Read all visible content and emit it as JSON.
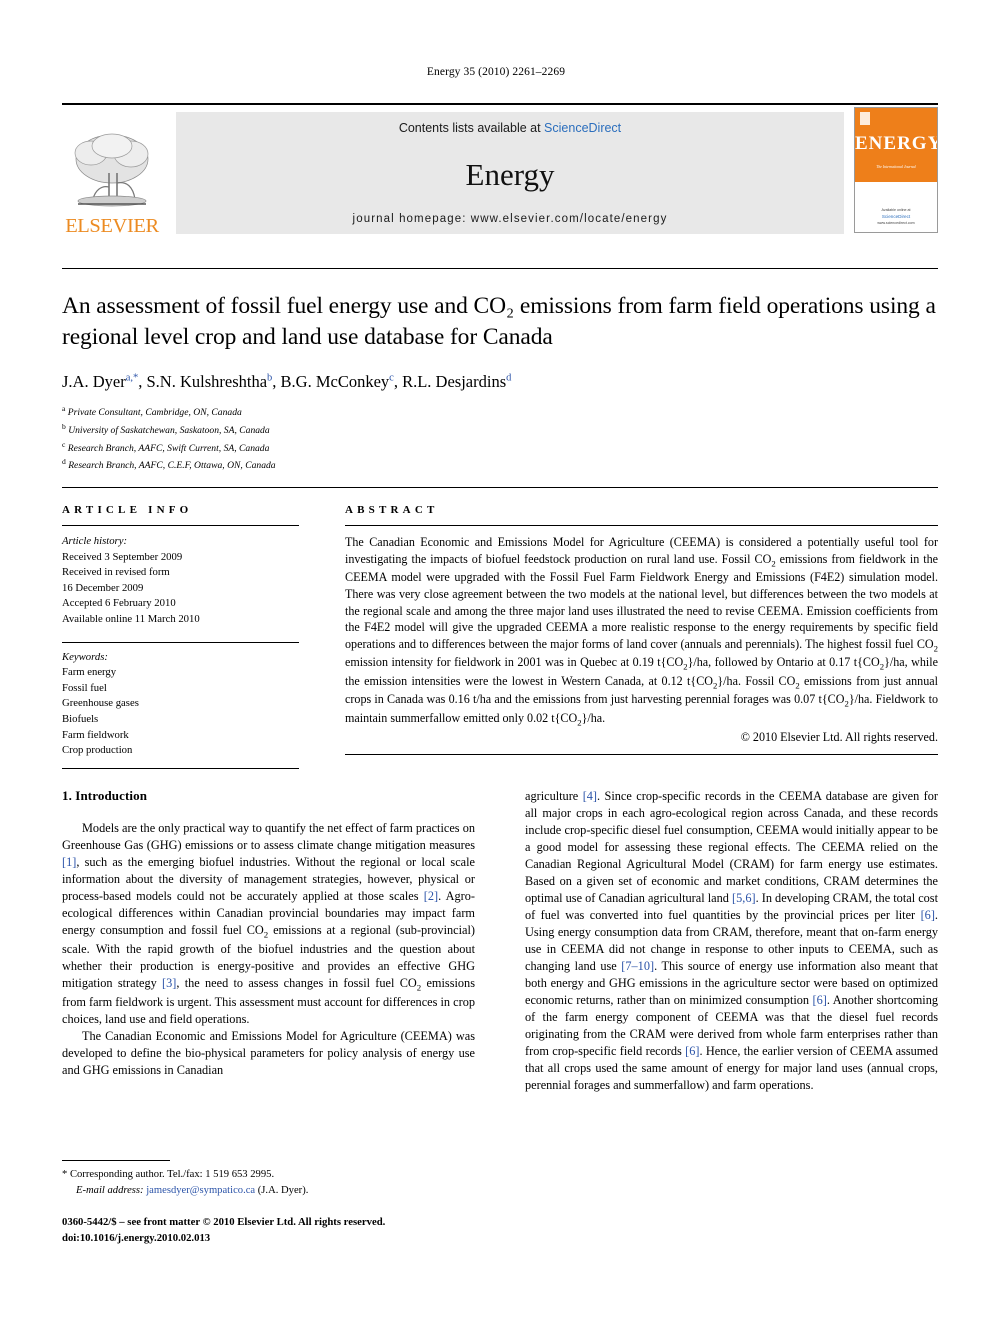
{
  "running_head": "Energy 35 (2010) 2261–2269",
  "masthead": {
    "contents_prefix": "Contents lists available at ",
    "sciencedirect": "ScienceDirect",
    "journal_name": "Energy",
    "homepage": "journal homepage: www.elsevier.com/locate/energy",
    "publisher_wordmark": "ELSEVIER",
    "publisher_logo_icon": "elsevier-tree-icon",
    "cover": {
      "title": "ENERGY",
      "subtitle": "The International Journal",
      "footer_prefix": "Available online at",
      "footer_brand": "ScienceDirect",
      "footer_url": "www.sciencedirect.com",
      "accent_color": "#ee7f1a"
    },
    "link_color": "#2b6ebd"
  },
  "article": {
    "title": "An assessment of fossil fuel energy use and CO₂ emissions from farm field operations using a regional level crop and land use database for Canada",
    "authors_html": "J.A. Dyer<sup>a,*</sup>, S.N. Kulshreshtha<sup>b</sup>, B.G. McConkey<sup>c</sup>, R.L. Desjardins<sup>d</sup>",
    "affiliations": [
      {
        "marker": "a",
        "text": "Private Consultant, Cambridge, ON, Canada"
      },
      {
        "marker": "b",
        "text": "University of Saskatchewan, Saskatoon, SA, Canada"
      },
      {
        "marker": "c",
        "text": "Research Branch, AAFC, Swift Current, SA, Canada"
      },
      {
        "marker": "d",
        "text": "Research Branch, AAFC, C.E.F, Ottawa, ON, Canada"
      }
    ]
  },
  "article_info": {
    "heading": "ARTICLE INFO",
    "history_label": "Article history:",
    "history": [
      "Received 3 September 2009",
      "Received in revised form",
      "16 December 2009",
      "Accepted 6 February 2010",
      "Available online 11 March 2010"
    ],
    "keywords_label": "Keywords:",
    "keywords": [
      "Farm energy",
      "Fossil fuel",
      "Greenhouse gases",
      "Biofuels",
      "Farm fieldwork",
      "Crop production"
    ]
  },
  "abstract": {
    "heading": "ABSTRACT",
    "body_html": "The Canadian Economic and Emissions Model for Agriculture (CEEMA) is considered a potentially useful tool for investigating the impacts of biofuel feedstock production on rural land use. Fossil CO<sub>2</sub> emissions from fieldwork in the CEEMA model were upgraded with the Fossil Fuel Farm Fieldwork Energy and Emissions (F4E2) simulation model. There was very close agreement between the two models at the national level, but differences between the two models at the regional scale and among the three major land uses illustrated the need to revise CEEMA. Emission coefficients from the F4E2 model will give the upgraded CEEMA a more realistic response to the energy requirements by specific field operations and to differences between the major forms of land cover (annuals and perennials). The highest fossil fuel CO<sub>2</sub> emission intensity for fieldwork in 2001 was in Quebec at 0.19 t{CO<sub>2</sub>}/ha, followed by Ontario at 0.17 t{CO<sub>2</sub>}/ha, while the emission intensities were the lowest in Western Canada, at 0.12 t{CO<sub>2</sub>}/ha. Fossil CO<sub>2</sub> emissions from just annual crops in Canada was 0.16 t/ha and the emissions from just harvesting perennial forages was 0.07 t{CO<sub>2</sub>}/ha. Fieldwork to maintain summerfallow emitted only 0.02 t{CO<sub>2</sub>}/ha.",
    "copyright": "© 2010 Elsevier Ltd. All rights reserved."
  },
  "body": {
    "section_number_title": "1. Introduction",
    "left_paragraphs_html": [
      "Models are the only practical way to quantify the net effect of farm practices on Greenhouse Gas (GHG) emissions or to assess climate change mitigation measures <span class=\"ref\">[1]</span>, such as the emerging biofuel industries. Without the regional or local scale information about the diversity of management strategies, however, physical or process-based models could not be accurately applied at those scales <span class=\"ref\">[2]</span>. Agro-ecological differences within Canadian provincial boundaries may impact farm energy consumption and fossil fuel CO<sub>2</sub> emissions at a regional (sub-provincial) scale. With the rapid growth of the biofuel industries and the question about whether their production is energy-positive and provides an effective GHG mitigation strategy <span class=\"ref\">[3]</span>, the need to assess changes in fossil fuel CO<sub>2</sub> emissions from farm fieldwork is urgent. This assessment must account for differences in crop choices, land use and field operations.",
      "The Canadian Economic and Emissions Model for Agriculture (CEEMA) was developed to define the bio-physical parameters for policy analysis of energy use and GHG emissions in Canadian"
    ],
    "right_paragraphs_html": [
      "agriculture <span class=\"ref\">[4]</span>. Since crop-specific records in the CEEMA database are given for all major crops in each agro-ecological region across Canada, and these records include crop-specific diesel fuel consumption, CEEMA would initially appear to be a good model for assessing these regional effects. The CEEMA relied on the Canadian Regional Agricultural Model (CRAM) for farm energy use estimates. Based on a given set of economic and market conditions, CRAM determines the optimal use of Canadian agricultural land <span class=\"ref\">[5,6]</span>. In developing CRAM, the total cost of fuel was converted into fuel quantities by the provincial prices per liter <span class=\"ref\">[6]</span>. Using energy consumption data from CRAM, therefore, meant that on-farm energy use in CEEMA did not change in response to other inputs to CEEMA, such as changing land use <span class=\"ref\">[7–10]</span>. This source of energy use information also meant that both energy and GHG emissions in the agriculture sector were based on optimized economic returns, rather than on minimized consumption <span class=\"ref\">[6]</span>. Another shortcoming of the farm energy component of CEEMA was that the diesel fuel records originating from the CRAM were derived from whole farm enterprises rather than from crop-specific field records <span class=\"ref\">[6]</span>. Hence, the earlier version of CEEMA assumed that all crops used the same amount of energy for major land uses (annual crops, perennial forages and summerfallow) and farm operations."
    ]
  },
  "footnote": {
    "corresponding_html": "* Corresponding author. Tel./fax: 1 519 653 2995.",
    "email_label": "E-mail address:",
    "email": "jamesdyer@sympatico.ca",
    "email_suffix": "(J.A. Dyer)."
  },
  "footer": {
    "line1": "0360-5442/$ – see front matter © 2010 Elsevier Ltd. All rights reserved.",
    "line2": "doi:10.1016/j.energy.2010.02.013"
  }
}
